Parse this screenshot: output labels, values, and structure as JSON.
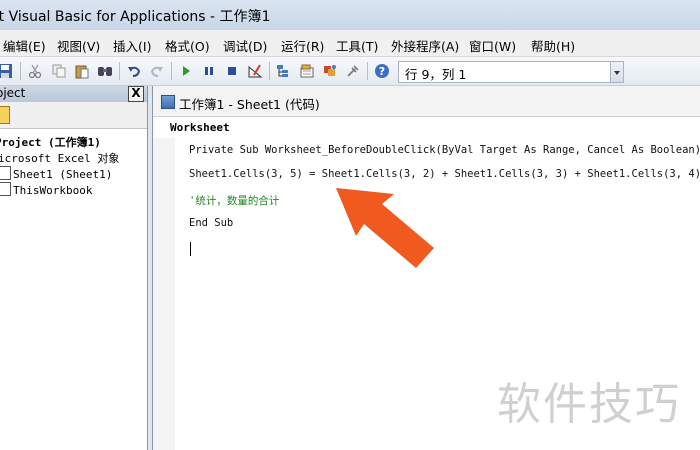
{
  "window": {
    "title": "ft Visual Basic for Applications - 工作簿1"
  },
  "menu": [
    {
      "label": "编辑(E)"
    },
    {
      "label": "视图(V)"
    },
    {
      "label": "插入(I)"
    },
    {
      "label": "格式(O)"
    },
    {
      "label": "调试(D)"
    },
    {
      "label": "运行(R)"
    },
    {
      "label": "工具(T)"
    },
    {
      "label": "外接程序(A)"
    },
    {
      "label": "窗口(W)"
    },
    {
      "label": "帮助(H)"
    }
  ],
  "toolbar": {
    "cursor_position": "行 9，列 1"
  },
  "project": {
    "pane_title": "oject",
    "close_glyph": "X",
    "tree": [
      {
        "label": "Project (工作簿1)"
      },
      {
        "label": "icrosoft Excel 对象"
      },
      {
        "label": "Sheet1 (Sheet1)"
      },
      {
        "label": "ThisWorkbook"
      }
    ]
  },
  "code_window": {
    "title": "工作簿1 - Sheet1 (代码)",
    "object_dropdown": "Worksheet",
    "lines": [
      "Private Sub Worksheet_BeforeDoubleClick(ByVal Target As Range, Cancel As Boolean)",
      "Sheet1.Cells(3, 5) = Sheet1.Cells(3, 2) + Sheet1.Cells(3, 3) + Sheet1.Cells(3, 4)",
      "'统计，数量的合计",
      "End Sub"
    ]
  },
  "watermark": {
    "text": "软件技巧"
  },
  "colors": {
    "annotation_arrow": "#f05a1e",
    "comment": "#1f8a1f"
  }
}
